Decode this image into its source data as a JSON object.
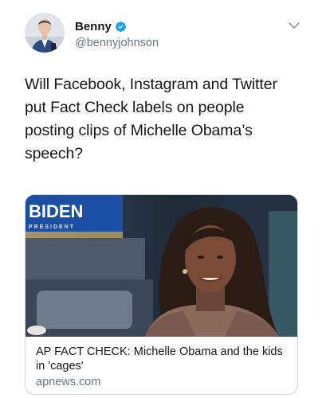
{
  "tweet": {
    "author": {
      "name": "Benny",
      "handle": "@bennyjohnson",
      "verified": true
    },
    "text": "Will Facebook, Instagram and Twitter put Fact Check labels on people posting clips of Michelle Obama’s speech?",
    "card": {
      "title": "AP FACT CHECK: Michelle Obama and the kids in 'cages'",
      "domain": "apnews.com",
      "image": {
        "sign_text": "BIDEN",
        "sign_subtext": "PRESIDENT"
      }
    }
  },
  "colors": {
    "verified_blue": "#1da1f2",
    "muted_text": "#657786",
    "primary_text": "#14171a",
    "card_border": "#ccd6dd"
  },
  "icons": {
    "verified": "verified-badge-icon",
    "menu": "chevron-down-icon"
  }
}
